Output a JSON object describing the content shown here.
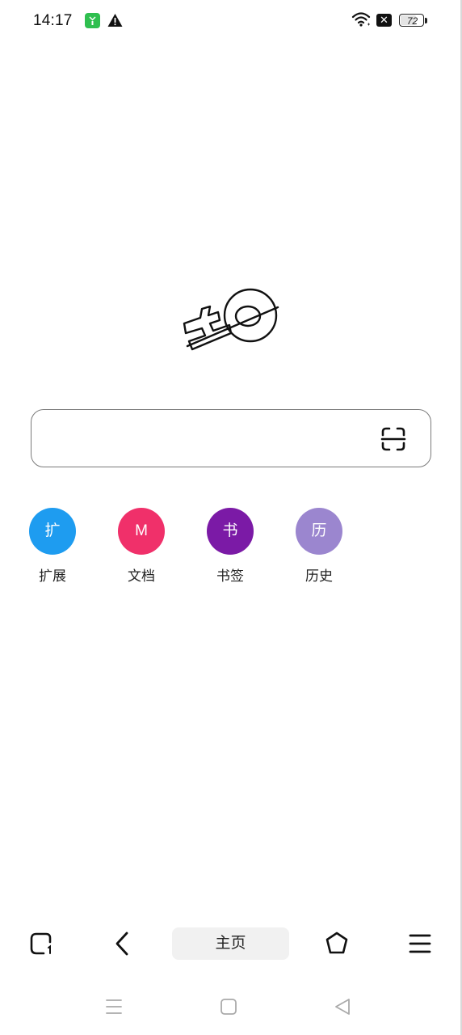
{
  "status_bar": {
    "time": "14:17",
    "battery": "72",
    "battery_level": 0.72,
    "icons": [
      "app-notification-icon",
      "warning-icon",
      "wifi-icon",
      "x-badge-icon",
      "battery-icon"
    ]
  },
  "logo": {
    "icon": "browser-logo-icon"
  },
  "search": {
    "placeholder": "",
    "value": "",
    "scan_icon": "scan-icon"
  },
  "shortcuts": [
    {
      "glyph": "扩",
      "label": "扩展",
      "color": "#1e9cf0"
    },
    {
      "glyph": "M",
      "label": "文档",
      "color": "#f0306a"
    },
    {
      "glyph": "书",
      "label": "书签",
      "color": "#7b1aa6"
    },
    {
      "glyph": "历",
      "label": "历史",
      "color": "#9b86cf"
    }
  ],
  "toolbar": {
    "home_label": "主页",
    "icons": [
      "tabs-icon",
      "back-icon",
      "home-tab",
      "hexagon-icon",
      "menu-icon"
    ]
  },
  "system_nav": {
    "icons": [
      "recents-icon",
      "home-icon",
      "back-triangle-icon"
    ]
  }
}
